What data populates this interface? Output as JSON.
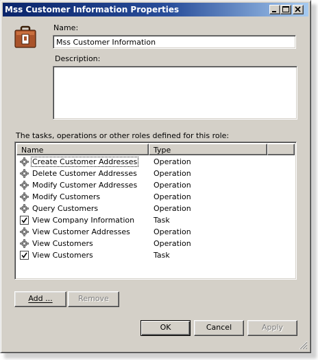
{
  "window": {
    "title": "Mss Customer Information Properties",
    "controls": {
      "minimize": "_",
      "maximize": "□",
      "close": "×"
    }
  },
  "icon": "toolbox-icon",
  "name_label": "Name:",
  "name_value": "Mss Customer Information",
  "description_label": "Description:",
  "description_value": "",
  "list_caption": "The tasks, operations or other roles defined for this role:",
  "list": {
    "columns": [
      "Name",
      "Type",
      ""
    ],
    "rows": [
      {
        "name": "Create Customer Addresses",
        "type": "Operation",
        "icon": "gear-icon"
      },
      {
        "name": "Delete Customer Addresses",
        "type": "Operation",
        "icon": "gear-icon"
      },
      {
        "name": "Modify Customer Addresses",
        "type": "Operation",
        "icon": "gear-icon"
      },
      {
        "name": "Modify Customers",
        "type": "Operation",
        "icon": "gear-icon"
      },
      {
        "name": "Query Customers",
        "type": "Operation",
        "icon": "gear-icon"
      },
      {
        "name": "View Company Information",
        "type": "Task",
        "icon": "task-checkbox-icon"
      },
      {
        "name": "View Customer Addresses",
        "type": "Operation",
        "icon": "gear-icon"
      },
      {
        "name": "View Customers",
        "type": "Operation",
        "icon": "gear-icon"
      },
      {
        "name": "View Customers",
        "type": "Task",
        "icon": "task-checkbox-icon"
      }
    ]
  },
  "buttons": {
    "add": "Add ...",
    "remove": "Remove",
    "ok": "OK",
    "cancel": "Cancel",
    "apply": "Apply"
  }
}
